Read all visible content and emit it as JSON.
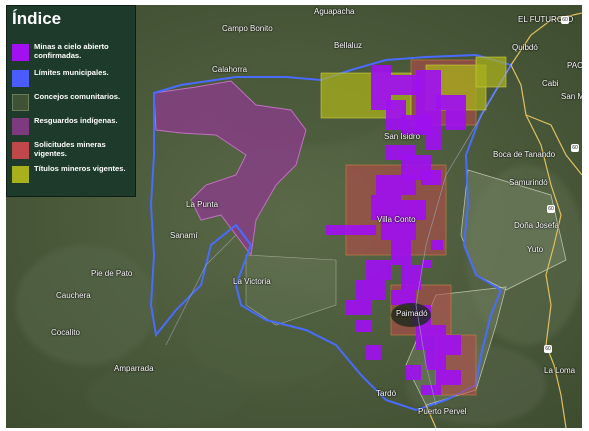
{
  "legend": {
    "title": "Índice",
    "items": [
      {
        "label": "Minas a cielo abierto confirmadas.",
        "color": "#a010f0"
      },
      {
        "label": "Límites municipales.",
        "color": "#4a5bff"
      },
      {
        "label": "Concejos comunitarios.",
        "color": "#3e5236"
      },
      {
        "label": "Resguardos indígenas.",
        "color": "#7e3a7e"
      },
      {
        "label": "Solicitudes mineras vigentes.",
        "color": "#c0484a"
      },
      {
        "label": "Títulos mineros vigentes.",
        "color": "#a8b01c"
      }
    ]
  },
  "places": {
    "aguapacha": "Aguapacha",
    "campo_bonito": "Campo Bonito",
    "el_futurclo": "EL FUTURCLO",
    "bellaluz": "Bellaluz",
    "quibdo": "Quibdó",
    "pac": "PAC",
    "cabi": "Cabi",
    "san_ma": "San Ma",
    "calahorra": "Calahorra",
    "san_isidro": "San Isidro",
    "boca_de_tanando": "Boca de Tanando",
    "samurindo": "Samurindó",
    "dona_josefa": "Doña Josefa",
    "yuto": "Yuto",
    "la_punta": "La Punta",
    "sanami": "Sanamí",
    "villa_conto": "Villa Conto",
    "pie_de_pato": "Pie de Pato",
    "la_victoria": "La Victoria",
    "cauchera": "Cauchera",
    "paimado": "Paimadó",
    "cocalito": "Cocalito",
    "amparrada": "Amparrada",
    "la_loma": "La Loma",
    "tardo": "Tardó",
    "puerto_pervel": "Puerto Pervel",
    "boca_de_ta": "Boca de Ta",
    "road_label_1": "Quibdó",
    "shield_1": "60",
    "shield_2": "60",
    "shield_3": "60",
    "shield_4": "60"
  }
}
